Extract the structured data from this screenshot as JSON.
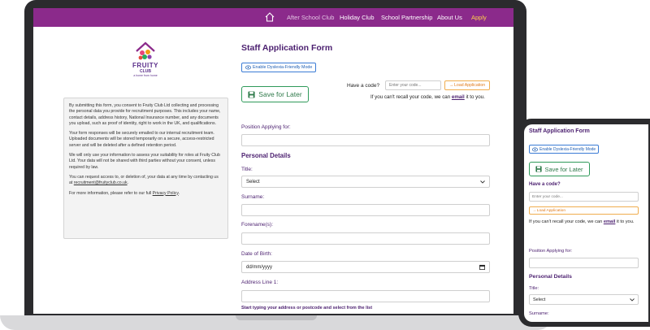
{
  "nav": {
    "items": [
      "After School Club",
      "Holiday Club",
      "School Partnership",
      "About Us",
      "Apply"
    ]
  },
  "logo": {
    "word": "FRUITY",
    "club": "CLUB",
    "tagline": "a home from home"
  },
  "consent": {
    "p1": "By submitting this form, you consent to Fruity Club Ltd collecting and processing the personal data you provide for recruitment purposes. This includes your name, contact details, address history, National Insurance number, and any documents you upload, such as proof of identity, right to work in the UK, and qualifications.",
    "p2": "Your form responses will be securely emailed to our internal recruitment team. Uploaded documents will be stored temporarily on a secure, access-restricted server and will be deleted after a defined retention period.",
    "p3": "We will only use your information to assess your suitability for roles at Fruity Club Ltd. Your data will not be shared with third parties without your consent, unless required by law.",
    "p4_prefix": "You can request access to, or deletion of, your data at any time by contacting us at ",
    "p4_email": "recruitment@fruityclub.co.uk",
    "p4_suffix": ".",
    "p5_prefix": "For more information, please refer to our full ",
    "p5_link": "Privacy Policy",
    "p5_suffix": "."
  },
  "form": {
    "title": "Staff Application Form",
    "dyslexia_button": "Enable Dyslexia-Friendly Mode",
    "save_button": "Save for Later",
    "code_label": "Have a code?",
    "code_placeholder": "Enter your code...",
    "load_button": "Load Application",
    "recall_prefix": "If you can't recall your code, we can ",
    "recall_link": "email",
    "recall_suffix": " it to you.",
    "position_label": "Position Applying for:",
    "personal_details": "Personal Details",
    "title_label": "Title:",
    "title_value": "Select",
    "surname_label": "Surname:",
    "forename_label": "Forename(s):",
    "dob_label": "Date of Birth:",
    "dob_placeholder": "dd/mm/yyyy",
    "address_label": "Address Line 1:",
    "address_hint": "Start typing your address or postcode and select from the list"
  },
  "mobile": {
    "title": "Staff Application Form",
    "dyslexia_button": "Enable Dyslexia-Friendly Mode",
    "save_button": "Save for Later",
    "code_label": "Have a code?",
    "code_placeholder": "Enter your code...",
    "load_button": "Load Application",
    "recall_prefix": "If you can't recall your code, we can ",
    "recall_link": "email",
    "recall_suffix": " it to you.",
    "position_label": "Position Applying for:",
    "personal_details": "Personal Details",
    "title_label": "Title:",
    "title_value": "Select",
    "surname_label": "Surname:"
  },
  "colors": {
    "brand_purple": "#8b2a8b",
    "heading_purple": "#4b1f6f",
    "save_green": "#2f9a5a",
    "load_orange": "#f0ad4e",
    "dyslexia_blue": "#3a7bd5",
    "apply_yellow": "#ffd24a"
  },
  "icons": [
    "home-icon",
    "eye-icon",
    "save-icon",
    "arrow-right-icon",
    "calendar-icon",
    "chevron-down-icon"
  ]
}
